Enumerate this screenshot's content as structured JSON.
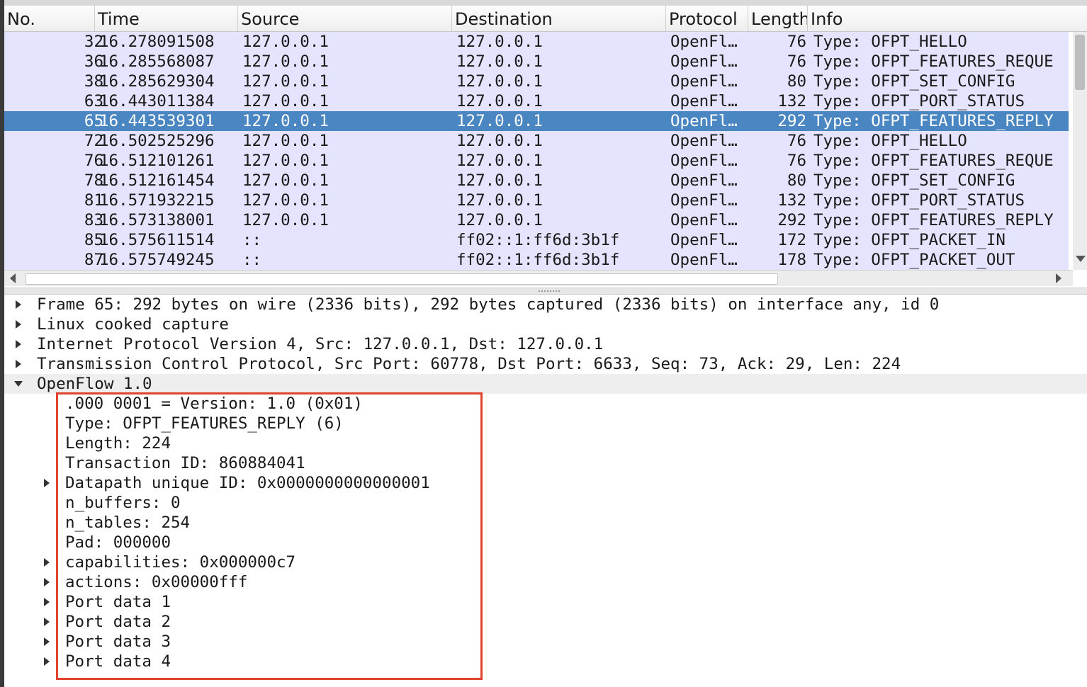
{
  "columns": {
    "no": "No.",
    "time": "Time",
    "source": "Source",
    "destination": "Destination",
    "protocol": "Protocol",
    "length": "Length",
    "info": "Info"
  },
  "packets": [
    {
      "no": "32",
      "time": "16.278091508",
      "src": "127.0.0.1",
      "dst": "127.0.0.1",
      "proto": "OpenFl…",
      "len": "76",
      "info": "Type: OFPT_HELLO"
    },
    {
      "no": "36",
      "time": "16.285568087",
      "src": "127.0.0.1",
      "dst": "127.0.0.1",
      "proto": "OpenFl…",
      "len": "76",
      "info": "Type: OFPT_FEATURES_REQUE"
    },
    {
      "no": "38",
      "time": "16.285629304",
      "src": "127.0.0.1",
      "dst": "127.0.0.1",
      "proto": "OpenFl…",
      "len": "80",
      "info": "Type: OFPT_SET_CONFIG"
    },
    {
      "no": "63",
      "time": "16.443011384",
      "src": "127.0.0.1",
      "dst": "127.0.0.1",
      "proto": "OpenFl…",
      "len": "132",
      "info": "Type: OFPT_PORT_STATUS"
    },
    {
      "no": "65",
      "time": "16.443539301",
      "src": "127.0.0.1",
      "dst": "127.0.0.1",
      "proto": "OpenFl…",
      "len": "292",
      "info": "Type: OFPT_FEATURES_REPLY"
    },
    {
      "no": "72",
      "time": "16.502525296",
      "src": "127.0.0.1",
      "dst": "127.0.0.1",
      "proto": "OpenFl…",
      "len": "76",
      "info": "Type: OFPT_HELLO"
    },
    {
      "no": "76",
      "time": "16.512101261",
      "src": "127.0.0.1",
      "dst": "127.0.0.1",
      "proto": "OpenFl…",
      "len": "76",
      "info": "Type: OFPT_FEATURES_REQUE"
    },
    {
      "no": "78",
      "time": "16.512161454",
      "src": "127.0.0.1",
      "dst": "127.0.0.1",
      "proto": "OpenFl…",
      "len": "80",
      "info": "Type: OFPT_SET_CONFIG"
    },
    {
      "no": "81",
      "time": "16.571932215",
      "src": "127.0.0.1",
      "dst": "127.0.0.1",
      "proto": "OpenFl…",
      "len": "132",
      "info": "Type: OFPT_PORT_STATUS"
    },
    {
      "no": "83",
      "time": "16.573138001",
      "src": "127.0.0.1",
      "dst": "127.0.0.1",
      "proto": "OpenFl…",
      "len": "292",
      "info": "Type: OFPT_FEATURES_REPLY"
    },
    {
      "no": "85",
      "time": "16.575611514",
      "src": "::",
      "dst": "ff02::1:ff6d:3b1f",
      "proto": "OpenFl…",
      "len": "172",
      "info": "Type: OFPT_PACKET_IN"
    },
    {
      "no": "87",
      "time": "16.575749245",
      "src": "::",
      "dst": "ff02::1:ff6d:3b1f",
      "proto": "OpenFl…",
      "len": "178",
      "info": "Type: OFPT_PACKET_OUT"
    }
  ],
  "selected_packet_no": "65",
  "details": {
    "frame": "Frame 65: 292 bytes on wire (2336 bits), 292 bytes captured (2336 bits) on interface any, id 0",
    "linux": "Linux cooked capture",
    "ip": "Internet Protocol Version 4, Src: 127.0.0.1, Dst: 127.0.0.1",
    "tcp": "Transmission Control Protocol, Src Port: 60778, Dst Port: 6633, Seq: 73, Ack: 29, Len: 224",
    "openflow": "OpenFlow 1.0",
    "fields": [
      {
        "text": ".000 0001 = Version: 1.0 (0x01)",
        "expandable": false
      },
      {
        "text": "Type: OFPT_FEATURES_REPLY (6)",
        "expandable": false
      },
      {
        "text": "Length: 224",
        "expandable": false
      },
      {
        "text": "Transaction ID: 860884041",
        "expandable": false
      },
      {
        "text": "Datapath unique ID: 0x0000000000000001",
        "expandable": true
      },
      {
        "text": "n_buffers: 0",
        "expandable": false
      },
      {
        "text": "n_tables: 254",
        "expandable": false
      },
      {
        "text": "Pad: 000000",
        "expandable": false
      },
      {
        "text": "capabilities: 0x000000c7",
        "expandable": true
      },
      {
        "text": "actions: 0x00000fff",
        "expandable": true
      },
      {
        "text": "Port data 1",
        "expandable": true
      },
      {
        "text": "Port data 2",
        "expandable": true
      },
      {
        "text": "Port data 3",
        "expandable": true
      },
      {
        "text": "Port data 4",
        "expandable": true
      }
    ]
  },
  "colors": {
    "row_bg": "#e4e4ff",
    "selected_bg": "#4a87c2",
    "highlight_border": "#e0432e"
  }
}
